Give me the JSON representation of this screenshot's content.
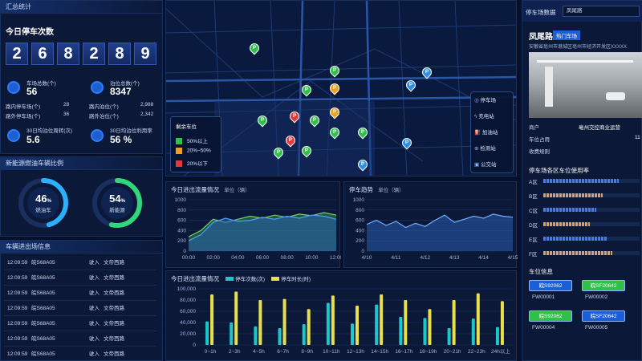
{
  "summary": {
    "title": "汇总统计",
    "today_label": "今日停车次数",
    "digits": [
      "2",
      "6",
      "8",
      "2",
      "8",
      "9"
    ],
    "lots_label": "车场总数(个)",
    "lots_value": "56",
    "berths_label": "泊位总数(个)",
    "berths_value": "8347",
    "road_in_label": "路内停车场(个)",
    "road_in_value": "28",
    "road_out_label": "路外停车场(个)",
    "road_out_value": "36",
    "berth_in_label": "路内泊位(个)",
    "berth_in_value": "2,988",
    "berth_out_label": "路外泊位(个)",
    "berth_out_value": "2,342",
    "turnover_label": "30日均泊位周转(次)",
    "turnover_value": "5.6",
    "usage_label": "30日均泊位利用率",
    "usage_value": "56 %"
  },
  "energy": {
    "title": "新能源燃油车辆比例",
    "fuel_pct": "46",
    "fuel_unit": "%",
    "fuel_label": "燃油车",
    "new_pct": "54",
    "new_unit": "%",
    "new_label": "新能源",
    "fuel_fraction": 0.46,
    "new_fraction": 0.54
  },
  "records": {
    "title": "车辆进出场信息",
    "rows": [
      {
        "time": "12:09:59",
        "plate": "皖S68A05",
        "action": "驶入",
        "place": "文帝西路"
      },
      {
        "time": "12:09:59",
        "plate": "皖S68A05",
        "action": "驶入",
        "place": "文帝西路"
      },
      {
        "time": "12:09:59",
        "plate": "皖S68A05",
        "action": "驶入",
        "place": "文帝西路"
      },
      {
        "time": "12:09:59",
        "plate": "皖S68A05",
        "action": "驶入",
        "place": "文帝西路"
      },
      {
        "time": "12:09:59",
        "plate": "皖S68A05",
        "action": "驶入",
        "place": "文帝西路"
      },
      {
        "time": "12:09:59",
        "plate": "皖S68A05",
        "action": "驶入",
        "place": "文帝西路"
      },
      {
        "time": "12:09:59",
        "plate": "皖S68A05",
        "action": "驶入",
        "place": "文帝西路"
      }
    ]
  },
  "map": {
    "legend_title": "剩余车位",
    "legend": [
      {
        "label": "50%以上",
        "color": "#2fbf4a"
      },
      {
        "label": "20%~50%",
        "color": "#f0a020"
      },
      {
        "label": "20%以下",
        "color": "#e03a3a"
      }
    ],
    "menu": [
      "停车场",
      "充电站",
      "加油站",
      "检测站",
      "公交站"
    ],
    "pin_icon": "P"
  },
  "flow_chart": {
    "title": "今日进出流量情况",
    "unit": "单位（辆）"
  },
  "trend_chart": {
    "title": "停车趋势",
    "unit": "单位（辆）"
  },
  "bar_chart": {
    "title": "今日进出流量情况",
    "legend_count": "停车次数(次)",
    "legend_duration": "停车时长(时)"
  },
  "chart_data": [
    {
      "type": "area",
      "title": "今日进出流量情况",
      "ylabel": "单位（辆）",
      "x": [
        "00:00",
        "02:00",
        "04:00",
        "06:00",
        "08:00",
        "10:00",
        "12:00"
      ],
      "yticks": [
        "1000",
        "800",
        "600",
        "400",
        "200",
        "0"
      ],
      "ylim": [
        0,
        1000
      ],
      "series": [
        {
          "values": [
            280,
            400,
            620,
            560,
            620,
            680,
            640,
            700,
            660,
            720,
            690,
            750,
            700
          ]
        },
        {
          "values": [
            200,
            320,
            560,
            640,
            580,
            600,
            660,
            620,
            680,
            640,
            700,
            680,
            620
          ]
        }
      ]
    },
    {
      "type": "area",
      "title": "停车趋势",
      "ylabel": "单位（辆）",
      "x": [
        "4/10",
        "4/11",
        "4/12",
        "4/13",
        "4/14",
        "4/15"
      ],
      "yticks": [
        "1000",
        "800",
        "600",
        "400",
        "200",
        "0"
      ],
      "ylim": [
        0,
        1000
      ],
      "series": [
        {
          "values": [
            520,
            600,
            500,
            580,
            460,
            540,
            480,
            600,
            700,
            560,
            620,
            680,
            640,
            720,
            680,
            660
          ]
        }
      ]
    },
    {
      "type": "bar",
      "title": "今日进出流量情况",
      "categories": [
        "0~1h",
        "2~3h",
        "4~5h",
        "6~7h",
        "8~9h",
        "10~11h",
        "12~13h",
        "14~15h",
        "16~17h",
        "18~19h",
        "20~21h",
        "22~23h",
        "24h以上"
      ],
      "yticks": [
        "100,000",
        "80,000",
        "60,000",
        "40,000",
        "20,000",
        "0"
      ],
      "ylim": [
        0,
        100000
      ],
      "series": [
        {
          "name": "停车次数(次)",
          "color": "#19c9c9",
          "values": [
            42000,
            40000,
            33000,
            30000,
            37000,
            75000,
            38000,
            72000,
            50000,
            48000,
            30000,
            47000,
            32000
          ]
        },
        {
          "name": "停车时长(时)",
          "color": "#e8e04a",
          "values": [
            90000,
            95000,
            80000,
            82000,
            64000,
            88000,
            70000,
            90000,
            80000,
            64000,
            80000,
            92000,
            78000
          ]
        }
      ]
    },
    {
      "type": "bar",
      "title": "停车场各区车位使用率",
      "categories": [
        "A区",
        "B区",
        "C区",
        "D区",
        "E区",
        "F区"
      ],
      "series": [
        {
          "values": [
            0.78,
            0.62,
            0.55,
            0.48,
            0.66,
            0.72
          ]
        }
      ]
    }
  ],
  "right": {
    "header_title": "停车场数据",
    "search_value": "凤尾路",
    "lot_name": "凤尾路",
    "hot_tag": "热门车场",
    "address": "安徽省亳州市谯城区亳州市经济开发区XXXXX",
    "merchant_label": "商户",
    "merchant_value": "亳州交控商业运营",
    "occupy_label": "车位占用",
    "occupy_value": "11",
    "fee_label": "收费规则",
    "usage_title": "停车场各区车位使用率",
    "zones": [
      "A区",
      "B区",
      "C区",
      "D区",
      "E区",
      "F区"
    ],
    "berth_title": "车位信息",
    "berths": [
      {
        "plate": "皖S92062",
        "code": "FW00001",
        "color": "#1b5fd6"
      },
      {
        "plate": "皖SF20642",
        "code": "FW00002",
        "color": "#2fbf4a"
      },
      {
        "plate": "皖S92062",
        "code": "FW00004",
        "color": "#2fbf4a"
      },
      {
        "plate": "皖SF20642",
        "code": "FW00005",
        "color": "#1b5fd6"
      }
    ]
  }
}
